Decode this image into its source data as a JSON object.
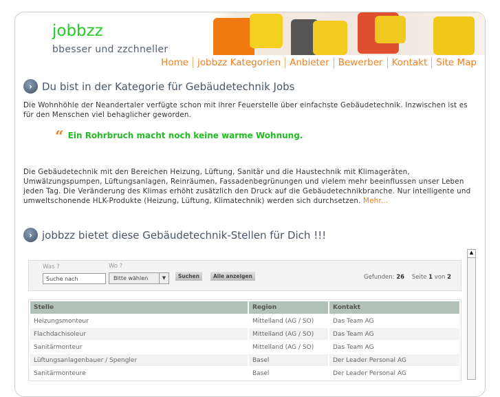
{
  "site": {
    "logo": "jobbzz",
    "tagline": "bbesser und zzchneller"
  },
  "nav": [
    "Home",
    "jobbzz Kategorien",
    "Anbieter",
    "Bewerber",
    "Kontakt",
    "Site Map"
  ],
  "section1": {
    "title": "Du bist in der Kategorie für Gebäudetechnik Jobs",
    "intro": "Die Wohnhöhle der Neandertaler verfügte schon mit ihrer Feuerstelle über einfachste Gebäudetechnik. Inzwischen ist es für den Menschen viel behaglicher geworden.",
    "quote_mark": "“",
    "quote": "Ein Rohrbruch macht noch keine warme Wohnung.",
    "body": "Die Gebäudetechnik mit den Bereichen Heizung, Lüftung, Sanitär und die Haustechnik mit Klimageräten, Umwälzungspumpen, Lüftungsanlagen, Reinräumen, Fassadenbegrünungen und vielem mehr beeinflussen unser Leben jeden Tag. Die Veränderung des Klimas erhöht zusätzlich den Druck auf die Gebäudetechnikbranche. Nur intelligente und umweltschonende HLK-Produkte (Heizung, Lüftung, Klimatechnik) werden sich durchsetzen. ",
    "more": "Mehr..."
  },
  "section2": {
    "title": "jobbzz bietet diese Gebäudetechnik-Stellen für Dich !!!"
  },
  "search": {
    "was_label": "Was ?",
    "wo_label": "Wo ?",
    "was_placeholder": "Suche nach",
    "wo_value": "Bitte wählen",
    "search_btn": "Suchen",
    "all_btn": "Alle anzeigen",
    "found_label": "Gefunden:",
    "found": "26",
    "page_label": "Seite",
    "page": "1",
    "of_label": "von",
    "pages": "2"
  },
  "table": {
    "headers": [
      "Stelle",
      "Region",
      "Kontakt"
    ],
    "rows": [
      [
        "Heizungsmonteur",
        "Mittelland (AG / SO)",
        "Das Team AG"
      ],
      [
        "Flachdachisoleur",
        "Mittelland (AG / SO)",
        "Das Team AG"
      ],
      [
        "Sanitärmonteur",
        "Mittelland (AG / SO)",
        "Das Team AG"
      ],
      [
        "Lüftungsanlagenbauer / Spengler",
        "Basel",
        "Der Leader Personal AG"
      ],
      [
        "Sanitärmonteure",
        "Basel",
        "Der Leader Personal AG"
      ]
    ]
  }
}
